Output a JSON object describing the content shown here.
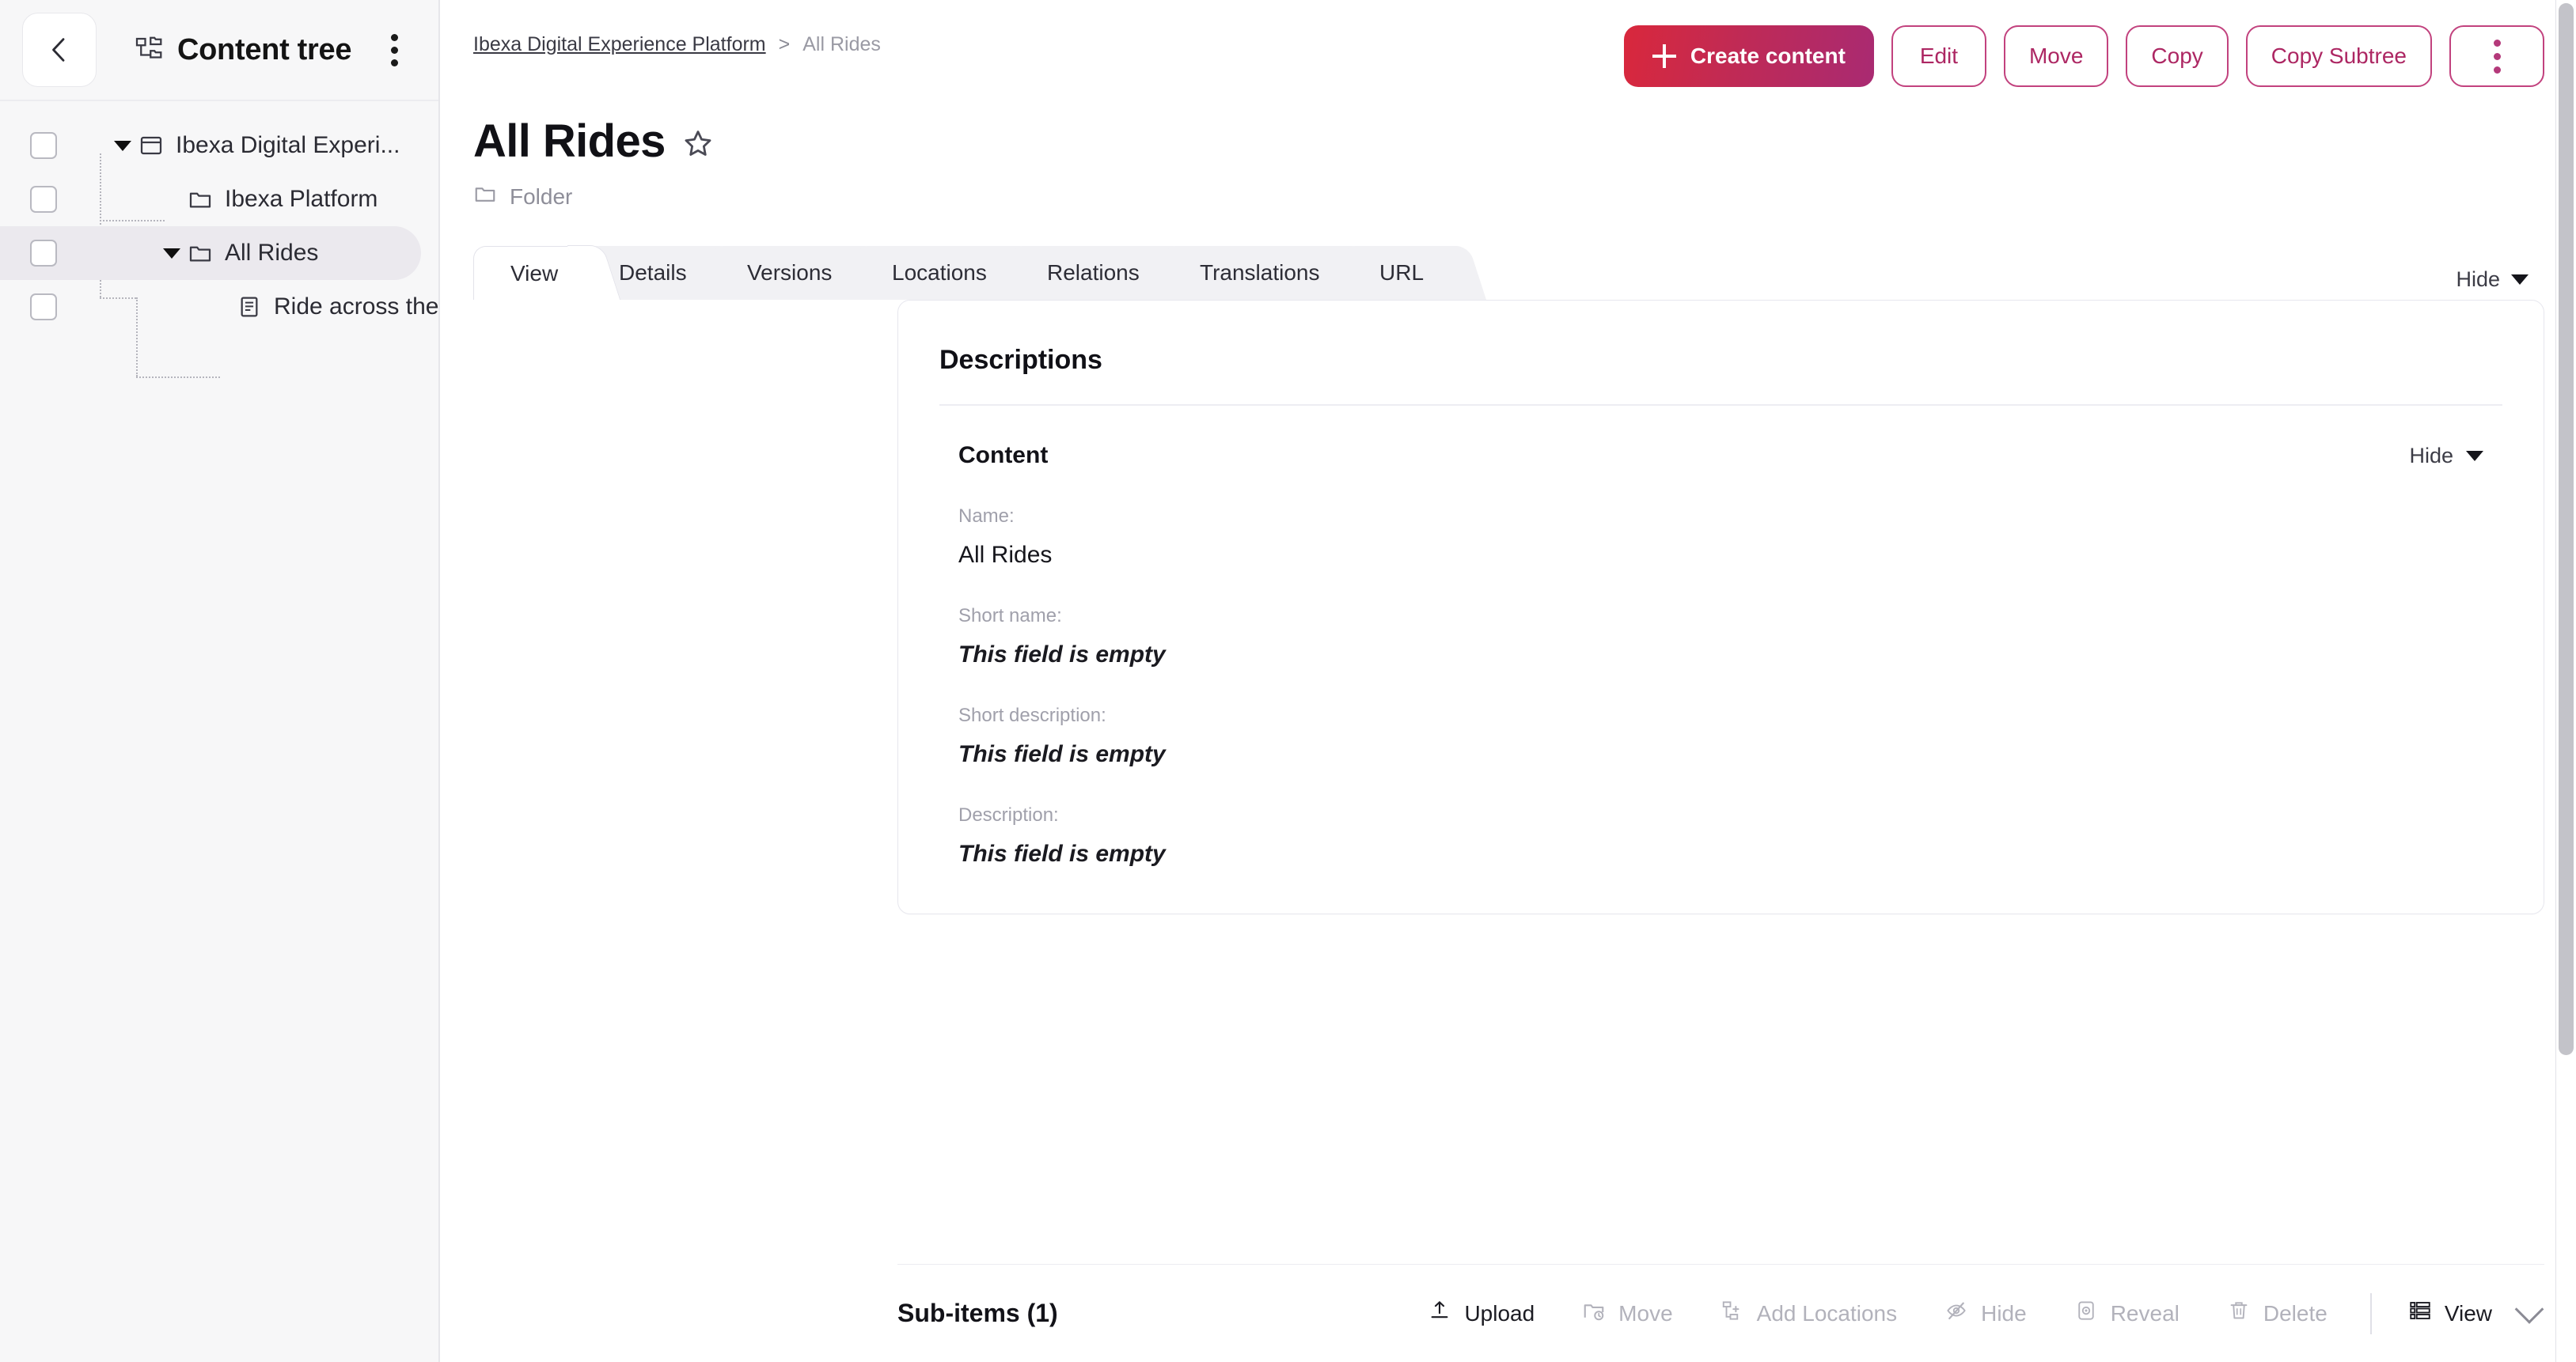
{
  "sidebar": {
    "title": "Content tree",
    "back_icon": "chevron-left-icon",
    "tree_icon": "content-tree-icon",
    "menu_icon": "kebab-menu-icon",
    "tree": [
      {
        "label": "Ibexa Digital Experi...",
        "icon": "site-window-icon",
        "depth": 0,
        "expanded": true,
        "selected": false,
        "has_caret": true
      },
      {
        "label": "Ibexa Platform",
        "icon": "folder-icon",
        "depth": 1,
        "expanded": false,
        "selected": false,
        "has_caret": false
      },
      {
        "label": "All Rides",
        "icon": "folder-icon",
        "depth": 1,
        "expanded": true,
        "selected": true,
        "has_caret": true
      },
      {
        "label": "Ride across the...",
        "icon": "document-icon",
        "depth": 2,
        "expanded": false,
        "selected": false,
        "has_caret": false
      }
    ]
  },
  "breadcrumb": {
    "root": "Ibexa Digital Experience Platform",
    "separator": ">",
    "current": "All Rides"
  },
  "toolbar": {
    "create_label": "Create content",
    "edit_label": "Edit",
    "move_label": "Move",
    "copy_label": "Copy",
    "copy_subtree_label": "Copy Subtree",
    "more_icon": "kebab-menu-icon"
  },
  "page": {
    "title": "All Rides",
    "bookmark_icon": "star-outline-icon",
    "content_type": "Folder",
    "content_type_icon": "folder-icon"
  },
  "tabs": {
    "items": [
      {
        "label": "View",
        "active": true
      },
      {
        "label": "Details",
        "active": false
      },
      {
        "label": "Versions",
        "active": false
      },
      {
        "label": "Locations",
        "active": false
      },
      {
        "label": "Relations",
        "active": false
      },
      {
        "label": "Translations",
        "active": false
      },
      {
        "label": "URL",
        "active": false
      }
    ],
    "hide_label": "Hide"
  },
  "card": {
    "title": "Descriptions",
    "section_title": "Content",
    "section_hide_label": "Hide",
    "fields": [
      {
        "label": "Name:",
        "value": "All Rides",
        "empty": false
      },
      {
        "label": "Short name:",
        "value": "This field is empty",
        "empty": true
      },
      {
        "label": "Short description:",
        "value": "This field is empty",
        "empty": true
      },
      {
        "label": "Description:",
        "value": "This field is empty",
        "empty": true
      }
    ]
  },
  "subitems": {
    "title": "Sub-items (1)",
    "actions": [
      {
        "label": "Upload",
        "icon": "upload-icon",
        "enabled": true
      },
      {
        "label": "Move",
        "icon": "move-folder-icon",
        "enabled": false
      },
      {
        "label": "Add Locations",
        "icon": "add-location-icon",
        "enabled": false
      },
      {
        "label": "Hide",
        "icon": "eye-slash-icon",
        "enabled": false
      },
      {
        "label": "Reveal",
        "icon": "reveal-eye-icon",
        "enabled": false
      },
      {
        "label": "Delete",
        "icon": "trash-icon",
        "enabled": false
      }
    ],
    "view_label": "View",
    "view_icon": "list-view-icon",
    "expand_icon": "chevron-down-icon"
  },
  "colors": {
    "accent": "#ad2763",
    "accent_border": "#c2427e",
    "gradient_from": "#d9283c",
    "gradient_to": "#a92a72",
    "sidebar_bg": "#f7f7f8",
    "selected_row": "#ebe9ee"
  }
}
